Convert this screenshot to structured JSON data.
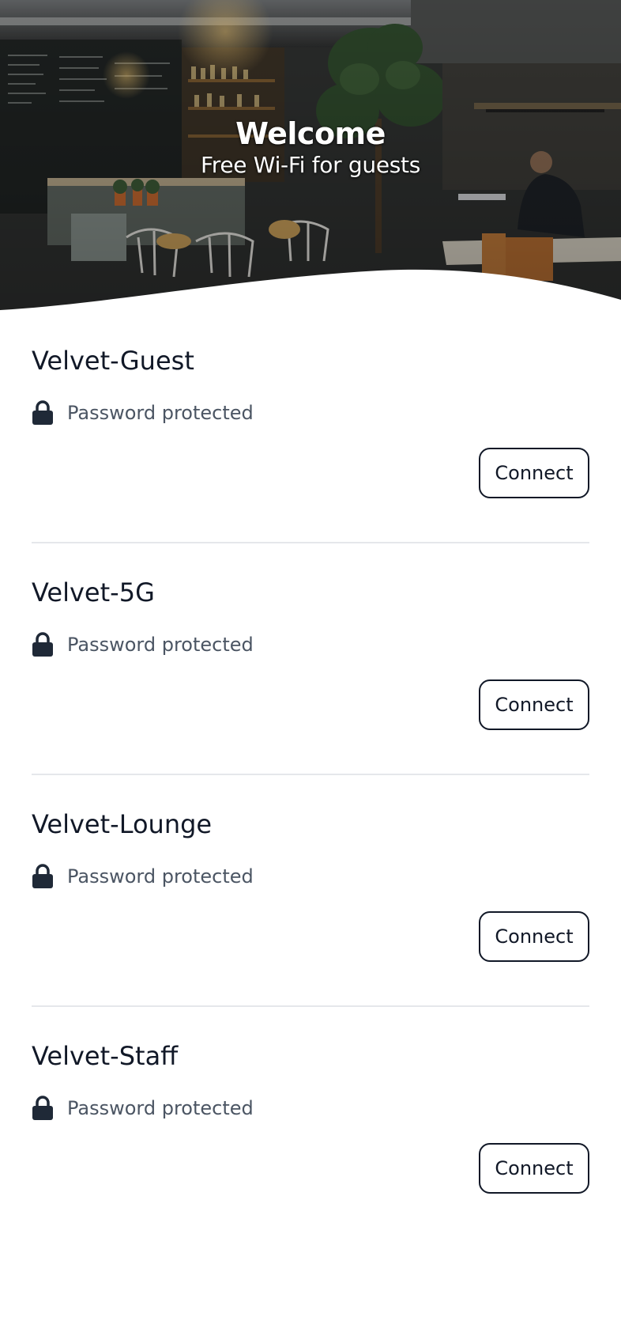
{
  "hero": {
    "title": "Welcome",
    "subtitle": "Free Wi-Fi for guests",
    "photo": "cafe-interior-photo"
  },
  "icons": {
    "security": "lock-icon"
  },
  "colors": {
    "text_primary": "#111827",
    "text_secondary": "#4b5563",
    "divider": "#e5e7eb",
    "button_border": "#111827"
  },
  "networks": [
    {
      "name": "Velvet-Guest",
      "security": "Password protected",
      "action": "Connect"
    },
    {
      "name": "Velvet-5G",
      "security": "Password protected",
      "action": "Connect"
    },
    {
      "name": "Velvet-Lounge",
      "security": "Password protected",
      "action": "Connect"
    },
    {
      "name": "Velvet-Staff",
      "security": "Password protected",
      "action": "Connect"
    }
  ]
}
